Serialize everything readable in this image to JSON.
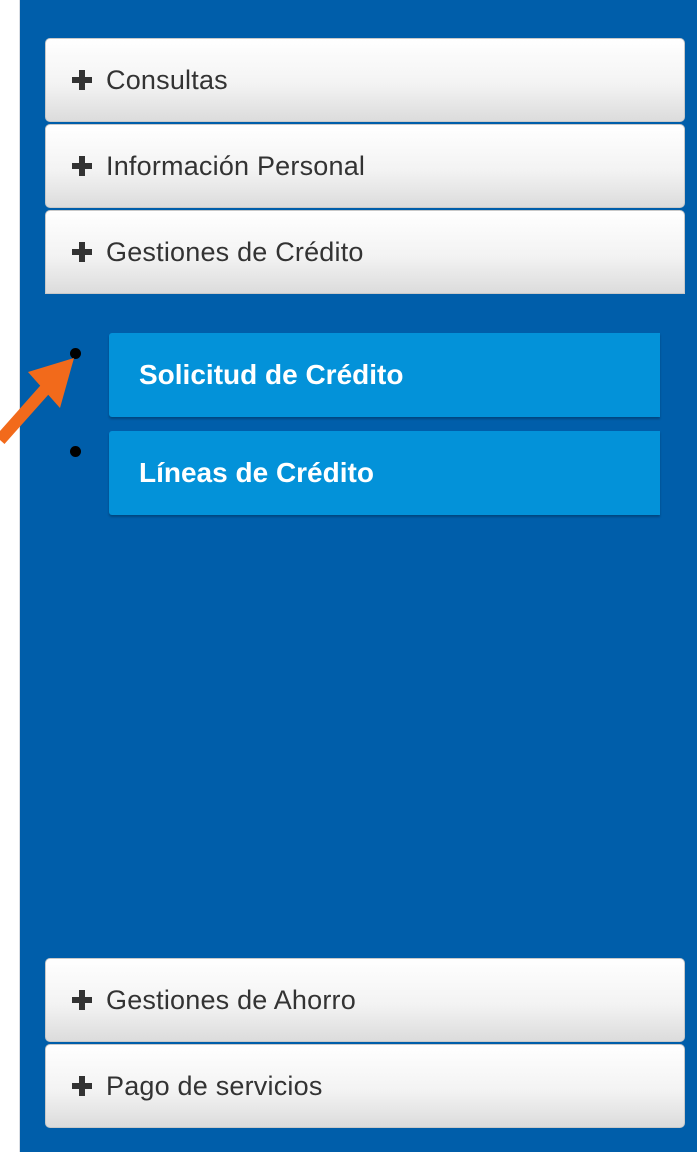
{
  "menu": {
    "top_items": [
      {
        "label": "Consultas"
      },
      {
        "label": "Información Personal"
      },
      {
        "label": "Gestiones de Crédito"
      }
    ],
    "sub_items": [
      {
        "label": "Solicitud de Crédito"
      },
      {
        "label": "Líneas de Crédito"
      }
    ],
    "bottom_items": [
      {
        "label": "Gestiones de Ahorro"
      },
      {
        "label": "Pago de servicios"
      }
    ]
  },
  "icons": {
    "expand": "plus-icon",
    "bullet": "bullet-dot",
    "annotation": "orange-arrow-icon"
  },
  "colors": {
    "panel_background": "#005eaa",
    "submenu_item": "#0392d9",
    "annotation_arrow": "#f26a1b",
    "header_text": "#333333"
  }
}
